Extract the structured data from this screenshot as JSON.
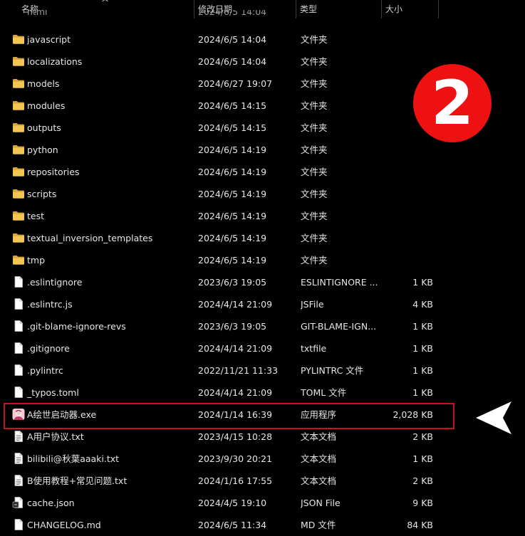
{
  "header": {
    "name": "名称",
    "date": "修改日期",
    "type": "类型",
    "size": "大小"
  },
  "partial_top_row": {
    "name": "html",
    "date": "2024/6/5 14:04"
  },
  "rows": [
    {
      "kind": "folder",
      "name": "javascript",
      "date": "2024/6/5 14:04",
      "type": "文件夹",
      "size": ""
    },
    {
      "kind": "folder",
      "name": "localizations",
      "date": "2024/6/5 14:04",
      "type": "文件夹",
      "size": ""
    },
    {
      "kind": "folder",
      "name": "models",
      "date": "2024/6/27 19:07",
      "type": "文件夹",
      "size": ""
    },
    {
      "kind": "folder",
      "name": "modules",
      "date": "2024/6/5 14:15",
      "type": "文件夹",
      "size": ""
    },
    {
      "kind": "folder",
      "name": "outputs",
      "date": "2024/6/5 14:15",
      "type": "文件夹",
      "size": ""
    },
    {
      "kind": "folder",
      "name": "python",
      "date": "2024/6/5 14:19",
      "type": "文件夹",
      "size": ""
    },
    {
      "kind": "folder",
      "name": "repositories",
      "date": "2024/6/5 14:19",
      "type": "文件夹",
      "size": ""
    },
    {
      "kind": "folder",
      "name": "scripts",
      "date": "2024/6/5 14:19",
      "type": "文件夹",
      "size": ""
    },
    {
      "kind": "folder",
      "name": "test",
      "date": "2024/6/5 14:19",
      "type": "文件夹",
      "size": ""
    },
    {
      "kind": "folder",
      "name": "textual_inversion_templates",
      "date": "2024/6/5 14:19",
      "type": "文件夹",
      "size": ""
    },
    {
      "kind": "folder",
      "name": "tmp",
      "date": "2024/6/5 14:19",
      "type": "文件夹",
      "size": ""
    },
    {
      "kind": "file",
      "name": ".eslintignore",
      "date": "2023/6/3 19:05",
      "type": "ESLINTIGNORE ...",
      "size": "1 KB"
    },
    {
      "kind": "file",
      "name": ".eslintrc.js",
      "date": "2024/4/14 21:09",
      "type": "JSFile",
      "size": "4 KB"
    },
    {
      "kind": "file",
      "name": ".git-blame-ignore-revs",
      "date": "2023/6/3 19:05",
      "type": "GIT-BLAME-IGN...",
      "size": "1 KB"
    },
    {
      "kind": "file",
      "name": ".gitignore",
      "date": "2024/4/14 21:09",
      "type": "txtfile",
      "size": "1 KB"
    },
    {
      "kind": "file",
      "name": ".pylintrc",
      "date": "2022/11/21 11:33",
      "type": "PYLINTRC 文件",
      "size": "1 KB"
    },
    {
      "kind": "file",
      "name": "_typos.toml",
      "date": "2024/4/14 21:09",
      "type": "TOML 文件",
      "size": "1 KB"
    },
    {
      "kind": "exe",
      "name": "A绘世启动器.exe",
      "date": "2024/1/14 16:39",
      "type": "应用程序",
      "size": "2,028 KB"
    },
    {
      "kind": "text",
      "name": "A用户协议.txt",
      "date": "2023/4/15 10:28",
      "type": "文本文档",
      "size": "2 KB"
    },
    {
      "kind": "text",
      "name": "bilibili@秋葉aaaki.txt",
      "date": "2023/9/30 20:21",
      "type": "文本文档",
      "size": "1 KB"
    },
    {
      "kind": "text",
      "name": "B使用教程+常见问题.txt",
      "date": "2024/1/16 17:55",
      "type": "文本文档",
      "size": "2 KB"
    },
    {
      "kind": "json",
      "name": "cache.json",
      "date": "2024/4/5 19:10",
      "type": "JSON File",
      "size": "9 KB"
    },
    {
      "kind": "file",
      "name": "CHANGELOG.md",
      "date": "2024/6/5 11:34",
      "type": "MD 文件",
      "size": "84 KB"
    }
  ],
  "annotation": {
    "badge_number": "2",
    "highlight_color": "#c4141c",
    "badge_color": "#ee1111"
  },
  "colors": {
    "background": "#000000",
    "folder": "#f2c14e",
    "text": "#e6e6e6"
  }
}
